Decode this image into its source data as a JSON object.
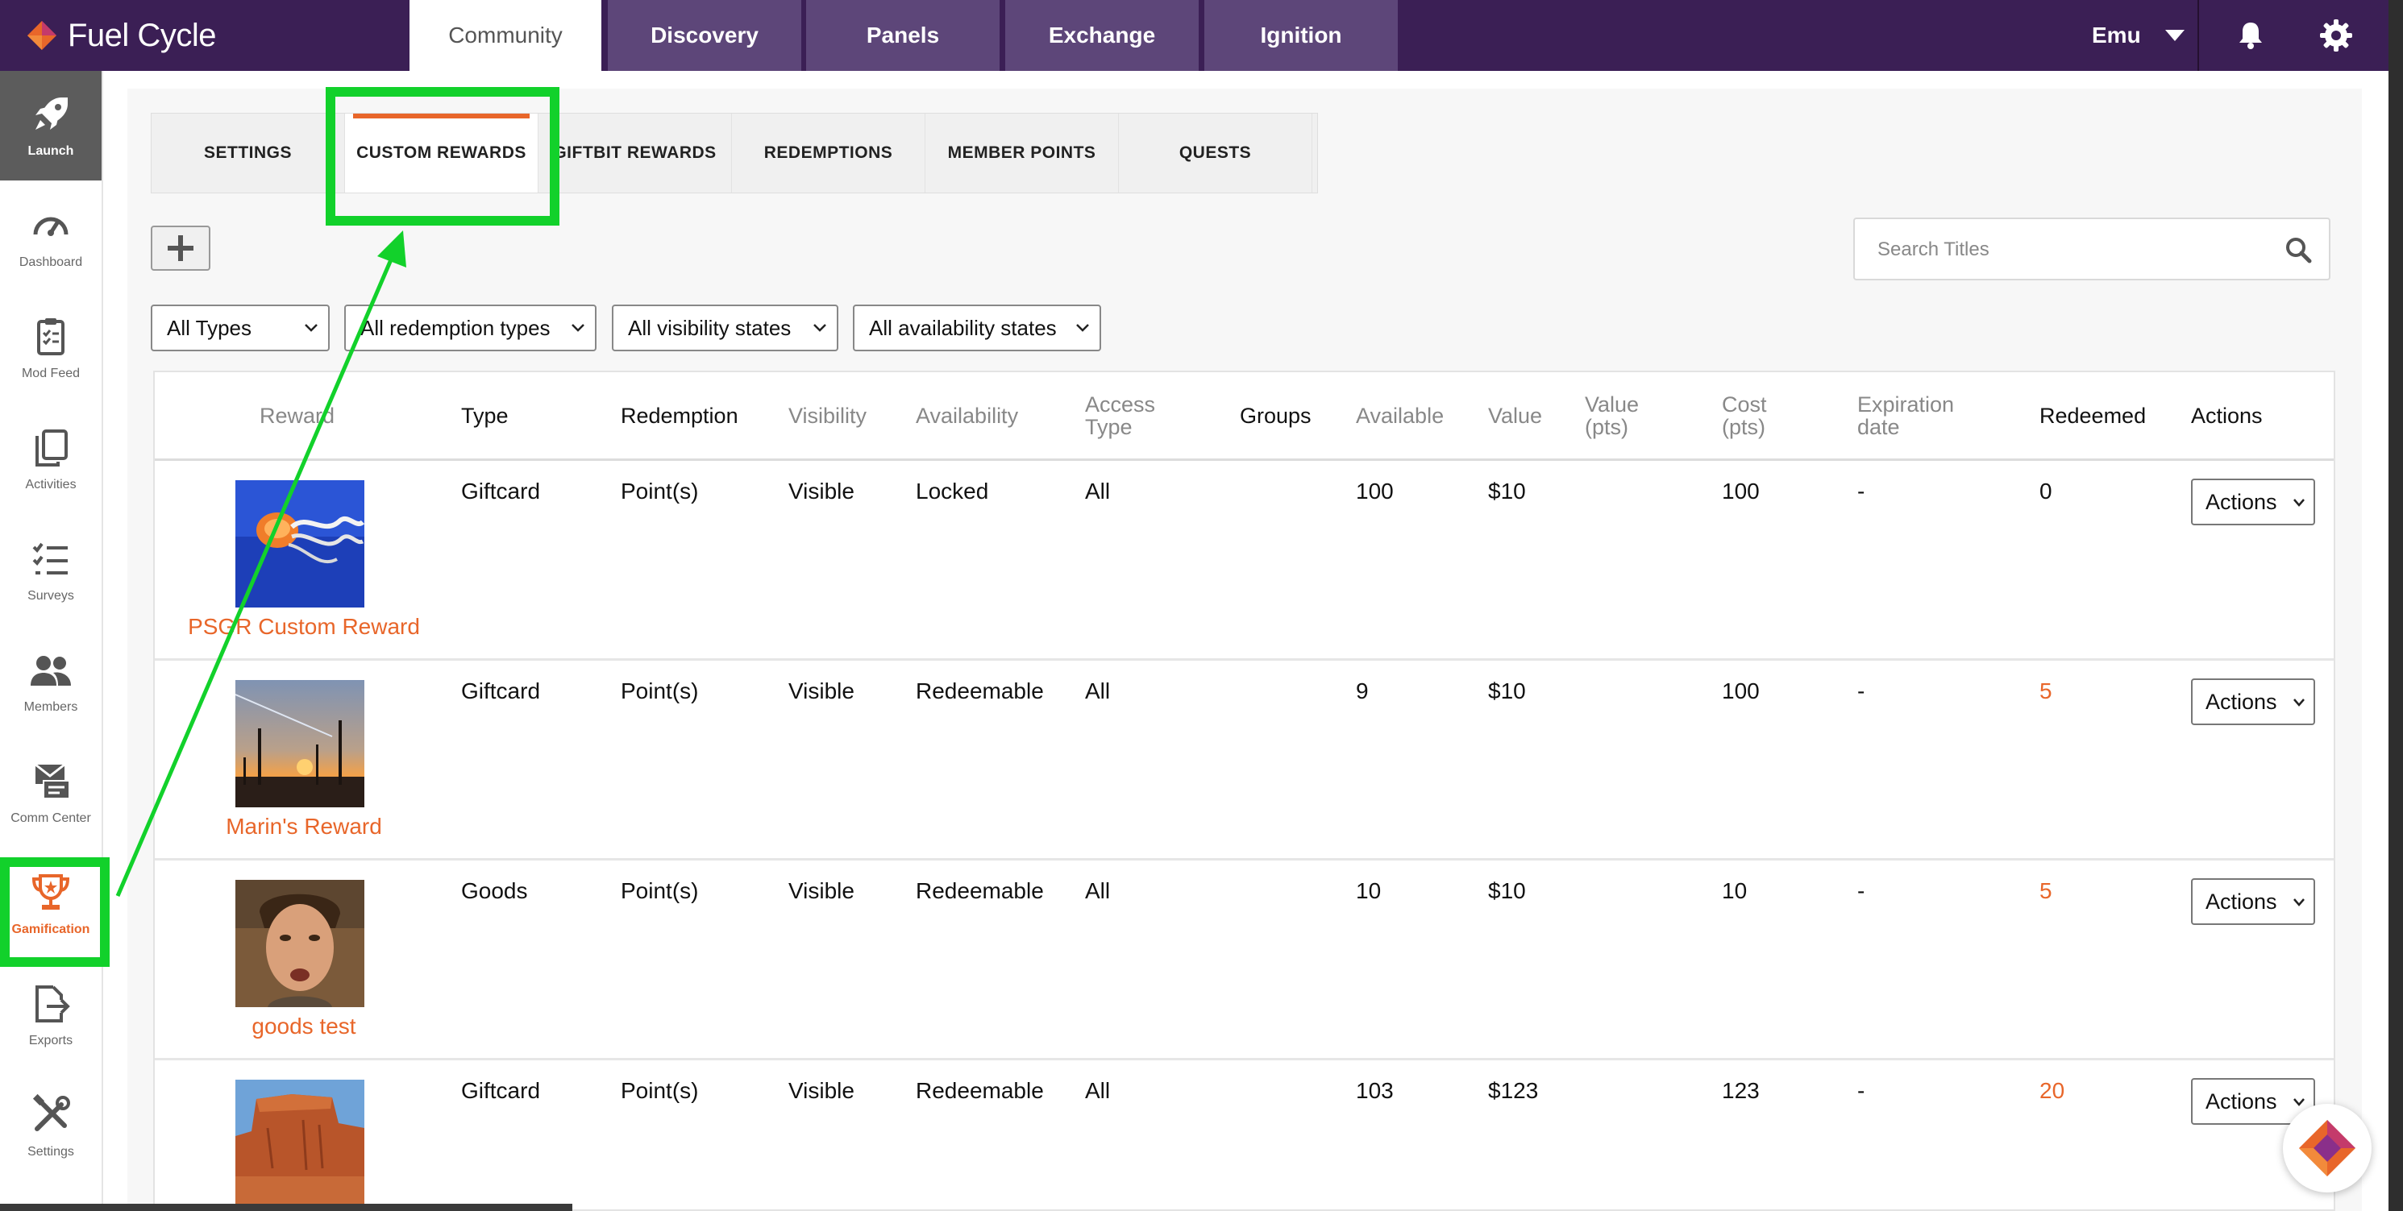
{
  "brand": {
    "name": "Fuel Cycle",
    "accent": "#e8662a",
    "nav_bg": "#3b1f55",
    "highlight": "#12d12b"
  },
  "topnav": {
    "tabs": [
      {
        "label": "Community",
        "active": true
      },
      {
        "label": "Discovery",
        "active": false
      },
      {
        "label": "Panels",
        "active": false
      },
      {
        "label": "Exchange",
        "active": false
      },
      {
        "label": "Ignition",
        "active": false
      }
    ],
    "user": "Emu",
    "icons": [
      "caret-down-icon",
      "bell-icon",
      "gear-icon"
    ]
  },
  "sidebar": {
    "items": [
      {
        "label": "Launch",
        "icon": "rocket-icon"
      },
      {
        "label": "Dashboard",
        "icon": "gauge-icon"
      },
      {
        "label": "Mod Feed",
        "icon": "clipboard-icon"
      },
      {
        "label": "Activities",
        "icon": "copy-icon"
      },
      {
        "label": "Surveys",
        "icon": "checklist-icon"
      },
      {
        "label": "Members",
        "icon": "users-icon"
      },
      {
        "label": "Comm Center",
        "icon": "mail-icon"
      },
      {
        "label": "Gamification",
        "icon": "trophy-icon",
        "active": true
      },
      {
        "label": "Exports",
        "icon": "export-icon"
      },
      {
        "label": "Settings",
        "icon": "tools-icon"
      }
    ]
  },
  "subtabs": [
    {
      "label": "SETTINGS"
    },
    {
      "label": "CUSTOM REWARDS",
      "active": true
    },
    {
      "label": "GIFTBIT REWARDS"
    },
    {
      "label": "REDEMPTIONS"
    },
    {
      "label": "MEMBER POINTS"
    },
    {
      "label": "QUESTS"
    }
  ],
  "search": {
    "placeholder": "Search Titles",
    "value": ""
  },
  "filters": [
    {
      "value": "All Types"
    },
    {
      "value": "All redemption types"
    },
    {
      "value": "All visibility states"
    },
    {
      "value": "All availability states"
    }
  ],
  "table": {
    "headers": {
      "reward": "Reward",
      "type": "Type",
      "redemption": "Redemption",
      "visibility": "Visibility",
      "availability": "Availability",
      "access_type_1": "Access",
      "access_type_2": "Type",
      "groups": "Groups",
      "available": "Available",
      "value": "Value",
      "value_pts_1": "Value",
      "value_pts_2": "(pts)",
      "cost_1": "Cost",
      "cost_2": "(pts)",
      "expiration_1": "Expiration",
      "expiration_2": "date",
      "redeemed": "Redeemed",
      "actions": "Actions"
    },
    "rows": [
      {
        "name": "PSGR Custom Reward",
        "image": "jellyfish-image",
        "type": "Giftcard",
        "redemption": "Point(s)",
        "visibility": "Visible",
        "availability": "Locked",
        "access_type": "All",
        "groups": "",
        "available": "100",
        "value": "$10",
        "value_pts": "",
        "cost": "100",
        "expiration": "-",
        "redeemed": "0",
        "redeemed_link": false,
        "actions": "Actions"
      },
      {
        "name": "Marin's Reward",
        "image": "sunset-image",
        "type": "Giftcard",
        "redemption": "Point(s)",
        "visibility": "Visible",
        "availability": "Redeemable",
        "access_type": "All",
        "groups": "",
        "available": "9",
        "value": "$10",
        "value_pts": "",
        "cost": "100",
        "expiration": "-",
        "redeemed": "5",
        "redeemed_link": true,
        "actions": "Actions"
      },
      {
        "name": "goods test",
        "image": "portrait-image",
        "type": "Goods",
        "redemption": "Point(s)",
        "visibility": "Visible",
        "availability": "Redeemable",
        "access_type": "All",
        "groups": "",
        "available": "10",
        "value": "$10",
        "value_pts": "",
        "cost": "10",
        "expiration": "-",
        "redeemed": "5",
        "redeemed_link": true,
        "actions": "Actions"
      },
      {
        "name": "",
        "image": "canyon-image",
        "type": "Giftcard",
        "redemption": "Point(s)",
        "visibility": "Visible",
        "availability": "Redeemable",
        "access_type": "All",
        "groups": "",
        "available": "103",
        "value": "$123",
        "value_pts": "",
        "cost": "123",
        "expiration": "-",
        "redeemed": "20",
        "redeemed_link": true,
        "actions": "Actions"
      }
    ]
  }
}
